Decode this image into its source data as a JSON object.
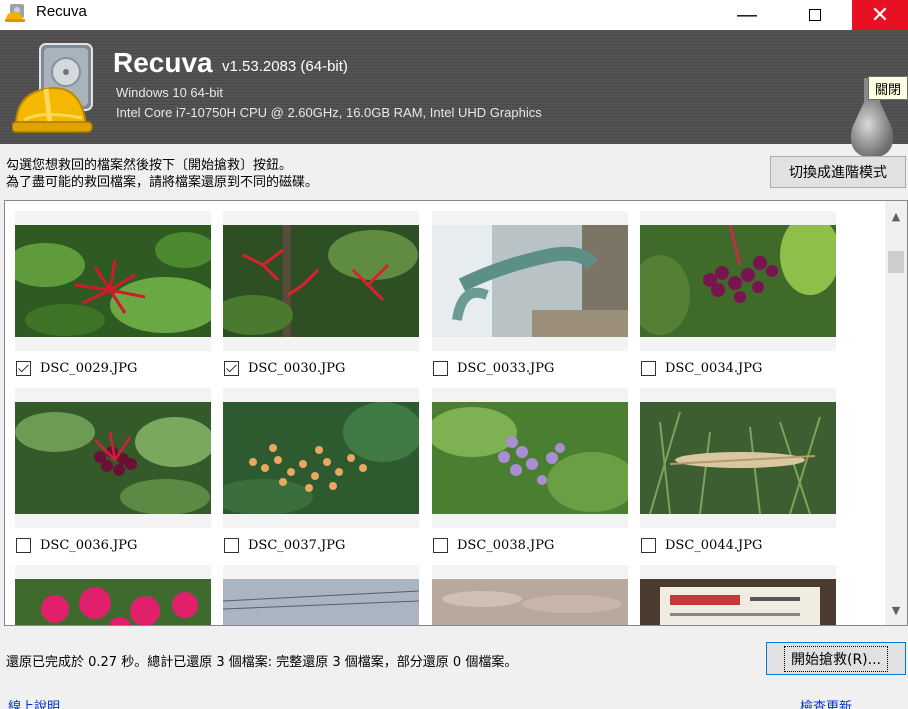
{
  "window": {
    "title": "Recuva",
    "minimize_glyph": "—",
    "close_glyph": "✕"
  },
  "header": {
    "app_name": "Recuva",
    "version": "v1.53.2083 (64-bit)",
    "os": "Windows 10 64-bit",
    "hardware": "Intel Core i7-10750H CPU @ 2.60GHz, 16.0GB RAM, Intel UHD Graphics",
    "close_tag": "關閉"
  },
  "instructions": {
    "line1": "勾選您想救回的檔案然後按下〔開始搶救〕按鈕。",
    "line2": "為了盡可能的救回檔案，請將檔案還原到不同的磁碟。"
  },
  "buttons": {
    "advanced_mode": "切換成進階模式",
    "recover": "開始搶救(R)..."
  },
  "files": [
    {
      "name": "DSC_0029.JPG",
      "checked": true
    },
    {
      "name": "DSC_0030.JPG",
      "checked": true
    },
    {
      "name": "DSC_0033.JPG",
      "checked": false
    },
    {
      "name": "DSC_0034.JPG",
      "checked": false
    },
    {
      "name": "DSC_0036.JPG",
      "checked": false
    },
    {
      "name": "DSC_0037.JPG",
      "checked": false
    },
    {
      "name": "DSC_0038.JPG",
      "checked": false
    },
    {
      "name": "DSC_0044.JPG",
      "checked": false
    }
  ],
  "status": {
    "text": "還原已完成於 0.27 秒。總計已還原 3 個檔案: 完整還原 3 個檔案，部分還原 0 個檔案。"
  },
  "links": {
    "online_help": "線上說明",
    "check_updates": "檢查更新"
  },
  "icons": {
    "app": "recuva-helmet-icon",
    "logo": "recuva-logo-icon",
    "bulb": "lightbulb-icon"
  }
}
